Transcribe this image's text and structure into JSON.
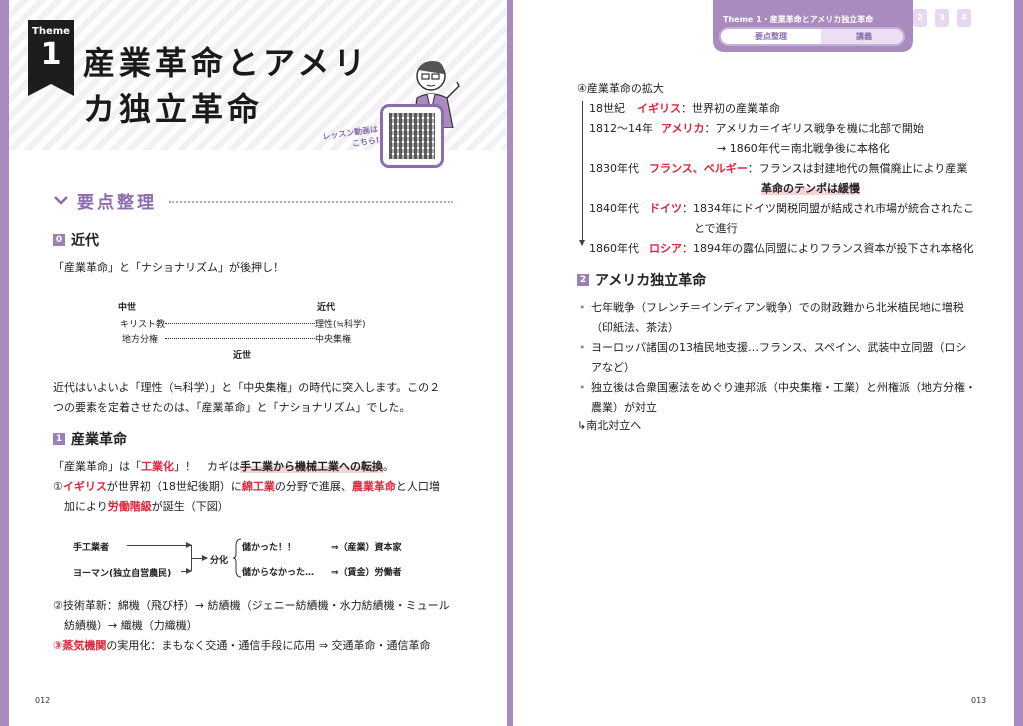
{
  "theme": {
    "word": "Theme",
    "number": "1"
  },
  "title_line1": "産業革命とアメリ",
  "title_line2": "カ独立革命",
  "lesson_link": "レッスン動画は こちら!",
  "summary_heading": "要点整理",
  "sections": {
    "s0": {
      "num": "0",
      "title": "近代"
    },
    "s1": {
      "num": "1",
      "title": "産業革命"
    },
    "s2": {
      "num": "2",
      "title": "アメリカ独立革命"
    }
  },
  "s0_line": "「産業革命」と「ナショナリズム」が後押し！",
  "diagram1": {
    "left_head": "中世",
    "right_head": "近代",
    "row1_left": "キリスト教",
    "row1_right": "理性(≒科学)",
    "row2_left": "地方分権",
    "row2_right": "中央集権",
    "bottom": "近世"
  },
  "s0_para": [
    "近代はいよいよ「理性（≒科学）」と「中央集権」の時代に突入します。この２",
    "つの要素を定着させたのは、「産業革命」と「ナショナリズム」でした。"
  ],
  "s1": {
    "intro_a": "「産業革命」は「",
    "intro_red": "工業化",
    "intro_b": "」！　カギは",
    "intro_hl": "手工業から機械工業への転換",
    "intro_c": "。",
    "item1_a": "①",
    "item1_red1": "イギリス",
    "item1_b": "が世界初（18世紀後期）に",
    "item1_red2": "綿工業",
    "item1_c": "の分野で進展、",
    "item1_red3": "農業革命",
    "item1_d": "と人口増",
    "item1_e": "加により",
    "item1_red4": "労働階級",
    "item1_f": "が誕生（下図）",
    "item2_l1": "②技術革新：綿機（飛び杼）→ 紡績機（ジェニー紡績機・水力紡績機・ミュール",
    "item2_l2": "紡績機）→ 織機（力織機）",
    "item3_red": "③蒸気機関",
    "item3_rest": "の実用化：まもなく交通・通信手段に応用 ⇒ 交通革命・通信革命"
  },
  "diagram2": {
    "a": "手工業者",
    "b": "ヨーマン(独立自営農民)",
    "split": "分化",
    "gain": "儲かった！！",
    "lose": "儲からなかった…",
    "gain_res": "⇒（産業）資本家",
    "lose_res": "⇒（賃金）労働者"
  },
  "header": {
    "label": "Theme 1・産業革命とアメリカ独立革命",
    "tab1": "要点整理",
    "tab2": "講義",
    "pages": [
      "2",
      "3",
      "4"
    ]
  },
  "expansion_title": "④産業革命の拡大",
  "timeline": [
    {
      "year": "18世紀",
      "country": "イギリス",
      "text": "：世界初の産業革命"
    },
    {
      "year": "1812〜14年",
      "country": "アメリカ",
      "text": "：アメリカ＝イギリス戦争を機に北部で開始"
    },
    {
      "year": "",
      "country": "",
      "text": "→ 1860年代＝南北戦争後に本格化"
    },
    {
      "year": "1830年代",
      "country": "フランス、ベルギー",
      "text": "：フランスは封建地代の無償廃止により産業"
    },
    {
      "year": "",
      "country": "",
      "text": "革命のテンポは緩慢"
    },
    {
      "year": "1840年代",
      "country": "ドイツ",
      "text": "：1834年にドイツ関税同盟が結成され市場が統合されたこ"
    },
    {
      "year": "",
      "country": "",
      "text": "とで進行"
    },
    {
      "year": "1860年代",
      "country": "ロシア",
      "text": "：1894年の露仏同盟によりフランス資本が投下され本格化"
    }
  ],
  "s2_bullets": [
    [
      "七年戦争（フレンチ＝インディアン戦争）での財政難から北米植民地に増税",
      "（印紙法、茶法）"
    ],
    [
      "ヨーロッパ諸国の13植民地支援…フランス、スペイン、武装中立同盟（ロシ",
      "アなど）"
    ],
    [
      "独立後は合衆国憲法をめぐり連邦派（中央集権・工業）と州権派（地方分権・",
      "農業）が対立"
    ]
  ],
  "s2_tail": "↳南北対立へ",
  "folio_left": "012",
  "folio_right": "013"
}
